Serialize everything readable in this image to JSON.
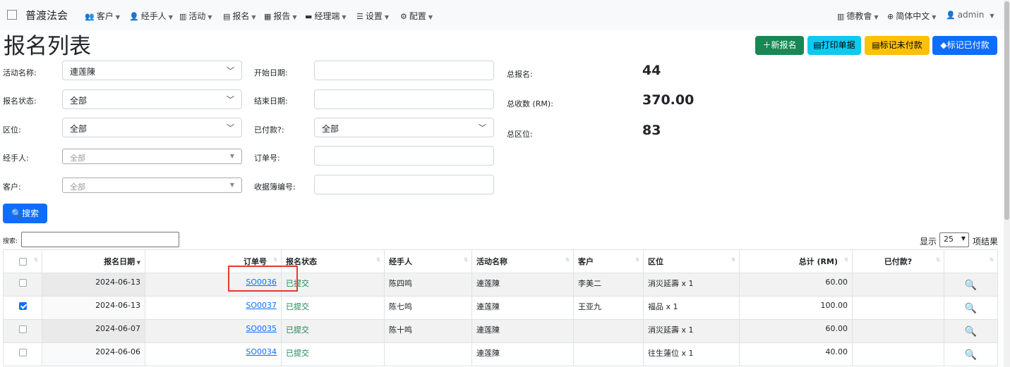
{
  "navbar": {
    "brand": "普渡法会",
    "items": [
      {
        "icon": "users-icon",
        "label": "客户"
      },
      {
        "icon": "user-icon",
        "label": "经手人"
      },
      {
        "icon": "map-icon",
        "label": "活动"
      },
      {
        "icon": "document-icon",
        "label": "报名"
      },
      {
        "icon": "report-icon",
        "label": "报告"
      },
      {
        "icon": "briefcase-icon",
        "label": "经理端"
      },
      {
        "icon": "sliders-icon",
        "label": "设置"
      },
      {
        "icon": "gear-icon",
        "label": "配置"
      }
    ],
    "org": "德教會",
    "language": "简体中文",
    "user": "admin"
  },
  "page_title": "报名列表",
  "actions": {
    "new_label": "新报名",
    "print_label": "打印单据",
    "mark_unpaid_label": "标记未付款",
    "mark_paid_label": "标记已付款"
  },
  "filters": {
    "activity_label": "活动名称:",
    "activity_value": "連莲陳",
    "status_label": "报名状态:",
    "status_value": "全部",
    "zone_label": "区位:",
    "zone_value": "全部",
    "handler_label": "经手人:",
    "handler_value": "全部",
    "customer_label": "客户:",
    "customer_value": "全部",
    "start_label": "开始日期:",
    "end_label": "结束日期:",
    "paid_label": "已付款?:",
    "paid_value": "全部",
    "order_label": "订单号:",
    "receipt_label": "收据簿编号:",
    "search_button": "搜索"
  },
  "stats": {
    "total_reg_label": "总报名:",
    "total_reg_value": "44",
    "total_income_label": "总收数 (RM):",
    "total_income_value": "370.00",
    "total_zone_label": "总区位:",
    "total_zone_value": "83"
  },
  "table_controls": {
    "search_label": "搜索:",
    "show_label": "显示",
    "page_length": "25",
    "suffix_label": "项结果"
  },
  "table": {
    "headers": [
      "报名日期",
      "订单号",
      "报名状态",
      "经手人",
      "活动名称",
      "客户",
      "区位",
      "总计 (RM)",
      "已付款?"
    ],
    "rows": [
      {
        "date": "2024-06-13",
        "order": "SO0036",
        "status": "已提交",
        "handler": "陈四鸣",
        "activity": "連莲陳",
        "customer": "李美二",
        "zone": "消災延壽 x 1",
        "total": "60.00",
        "checked": false
      },
      {
        "date": "2024-06-13",
        "order": "SO0037",
        "status": "已提交",
        "handler": "陈七鸣",
        "activity": "連莲陳",
        "customer": "王亚九",
        "zone": "福品 x 1",
        "total": "100.00",
        "checked": true
      },
      {
        "date": "2024-06-07",
        "order": "SO0035",
        "status": "已提交",
        "handler": "陈十鸣",
        "activity": "連莲陳",
        "customer": "",
        "zone": "消災延壽 x 1",
        "total": "60.00",
        "checked": false
      },
      {
        "date": "2024-06-06",
        "order": "SO0034",
        "status": "已提交",
        "handler": "",
        "activity": "連莲陳",
        "customer": "",
        "zone": "往生蓮位 x 1",
        "total": "40.00",
        "checked": false
      }
    ]
  }
}
